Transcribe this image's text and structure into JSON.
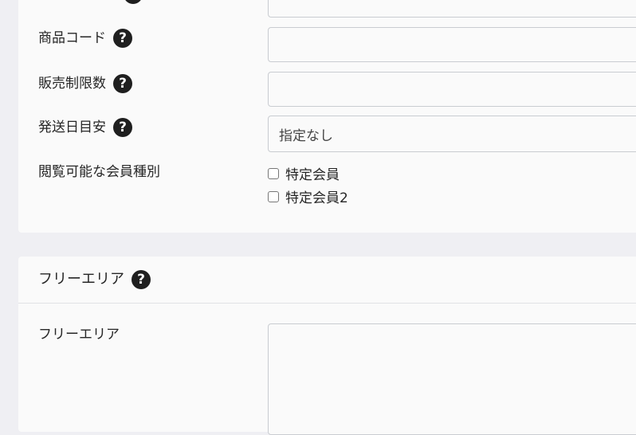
{
  "fields": {
    "product_code_label": "商品コード",
    "sales_limit_label": "販売制限数",
    "shipping_label": "発送日目安",
    "shipping_value": "指定なし",
    "member_type_label": "閲覧可能な会員種別",
    "member_options": [
      "特定会員",
      "特定会員2"
    ]
  },
  "free_area": {
    "section_title": "フリーエリア",
    "field_label": "フリーエリア"
  },
  "icons": {
    "help": "?"
  }
}
